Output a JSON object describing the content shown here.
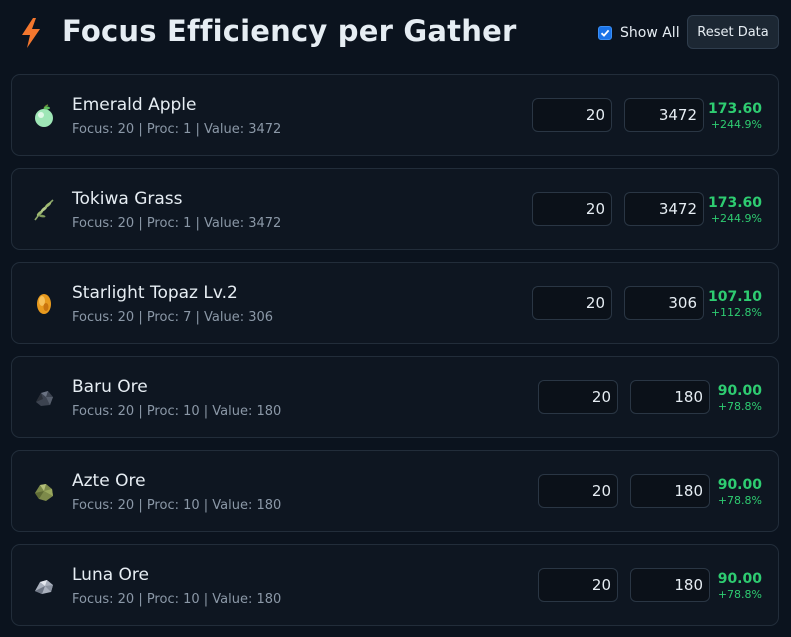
{
  "header": {
    "title": "Focus Efficiency per Gather",
    "show_all_label": "Show All",
    "show_all_checked": true,
    "reset_label": "Reset Data",
    "accent": "#1a73e8",
    "bolt_color": "#f4772e"
  },
  "items": [
    {
      "name": "Emerald Apple",
      "meta": "Focus: 20 | Proc: 1 | Value: 3472",
      "focus_input": "20",
      "value_input": "3472",
      "score": "173.60",
      "pct": "+244.9%",
      "icon": "apple-icon"
    },
    {
      "name": "Tokiwa Grass",
      "meta": "Focus: 20 | Proc: 1 | Value: 3472",
      "focus_input": "20",
      "value_input": "3472",
      "score": "173.60",
      "pct": "+244.9%",
      "icon": "grass-icon"
    },
    {
      "name": "Starlight Topaz Lv.2",
      "meta": "Focus: 20 | Proc: 7 | Value: 306",
      "focus_input": "20",
      "value_input": "306",
      "score": "107.10",
      "pct": "+112.8%",
      "icon": "topaz-icon"
    },
    {
      "name": "Baru Ore",
      "meta": "Focus: 20 | Proc: 10 | Value: 180",
      "focus_input": "20",
      "value_input": "180",
      "score": "90.00",
      "pct": "+78.8%",
      "icon": "ore-icon"
    },
    {
      "name": "Azte Ore",
      "meta": "Focus: 20 | Proc: 10 | Value: 180",
      "focus_input": "20",
      "value_input": "180",
      "score": "90.00",
      "pct": "+78.8%",
      "icon": "ore-icon"
    },
    {
      "name": "Luna Ore",
      "meta": "Focus: 20 | Proc: 10 | Value: 180",
      "focus_input": "20",
      "value_input": "180",
      "score": "90.00",
      "pct": "+78.8%",
      "icon": "ore-icon"
    }
  ],
  "colors": {
    "positive": "#2ecc71",
    "background": "#0b131e",
    "card": "#0e1621"
  }
}
